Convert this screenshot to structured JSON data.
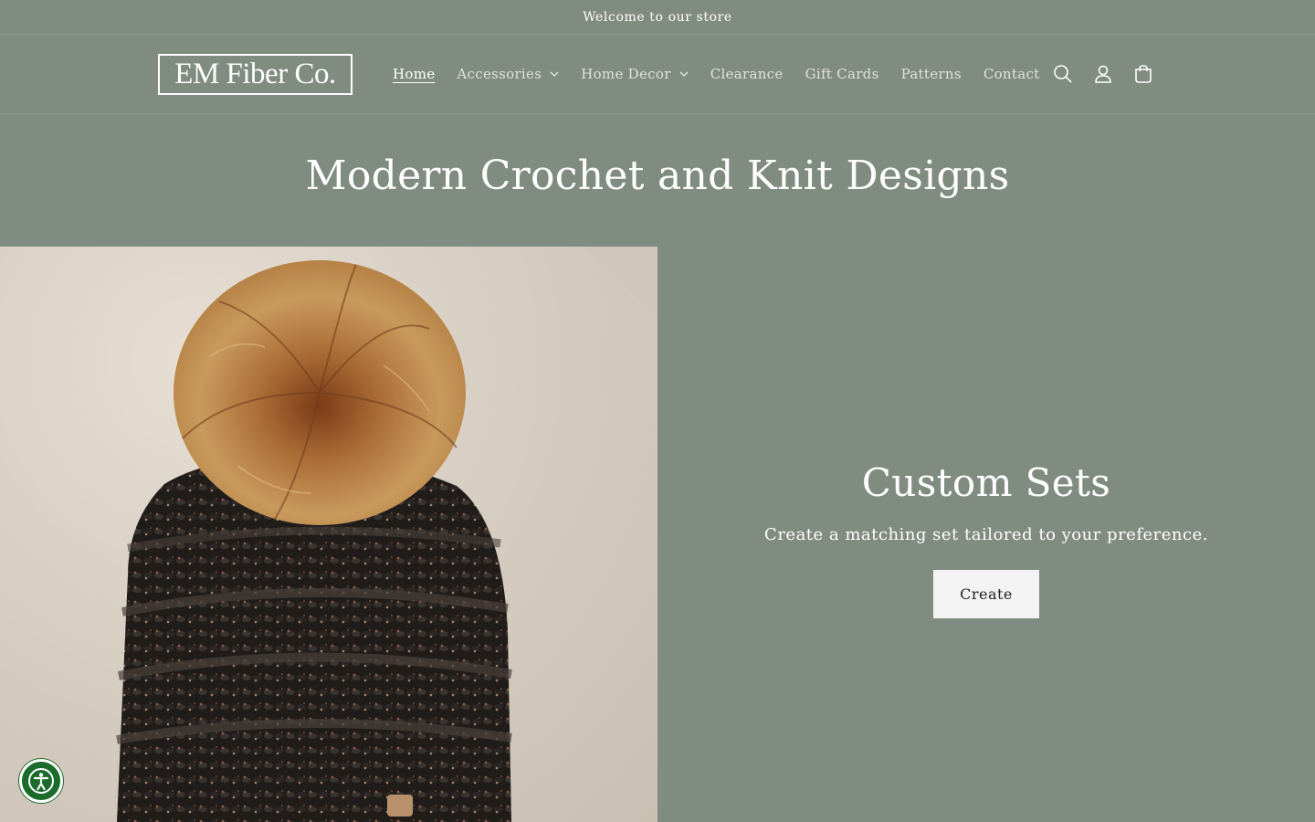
{
  "announcement": {
    "text": "Welcome to our store"
  },
  "header": {
    "logo_text": "EM Fiber Co.",
    "nav": [
      {
        "label": "Home",
        "active": true,
        "dropdown": false
      },
      {
        "label": "Accessories",
        "active": false,
        "dropdown": true
      },
      {
        "label": "Home Decor",
        "active": false,
        "dropdown": true
      },
      {
        "label": "Clearance",
        "active": false,
        "dropdown": false
      },
      {
        "label": "Gift Cards",
        "active": false,
        "dropdown": false
      },
      {
        "label": "Patterns",
        "active": false,
        "dropdown": false
      },
      {
        "label": "Contact",
        "active": false,
        "dropdown": false
      }
    ],
    "icons": [
      "search-icon",
      "account-icon",
      "cart-icon"
    ]
  },
  "hero": {
    "title": "Modern Crochet and Knit Designs"
  },
  "promo": {
    "heading": "Custom Sets",
    "text": "Create a matching set tailored to your preference.",
    "button_label": "Create"
  },
  "accessibility": {
    "icon": "accessibility-icon"
  },
  "colors": {
    "background": "#818c80",
    "text": "#ffffff",
    "button_bg": "#f3f3f3",
    "accessibility_bg": "#1b6b2b"
  }
}
